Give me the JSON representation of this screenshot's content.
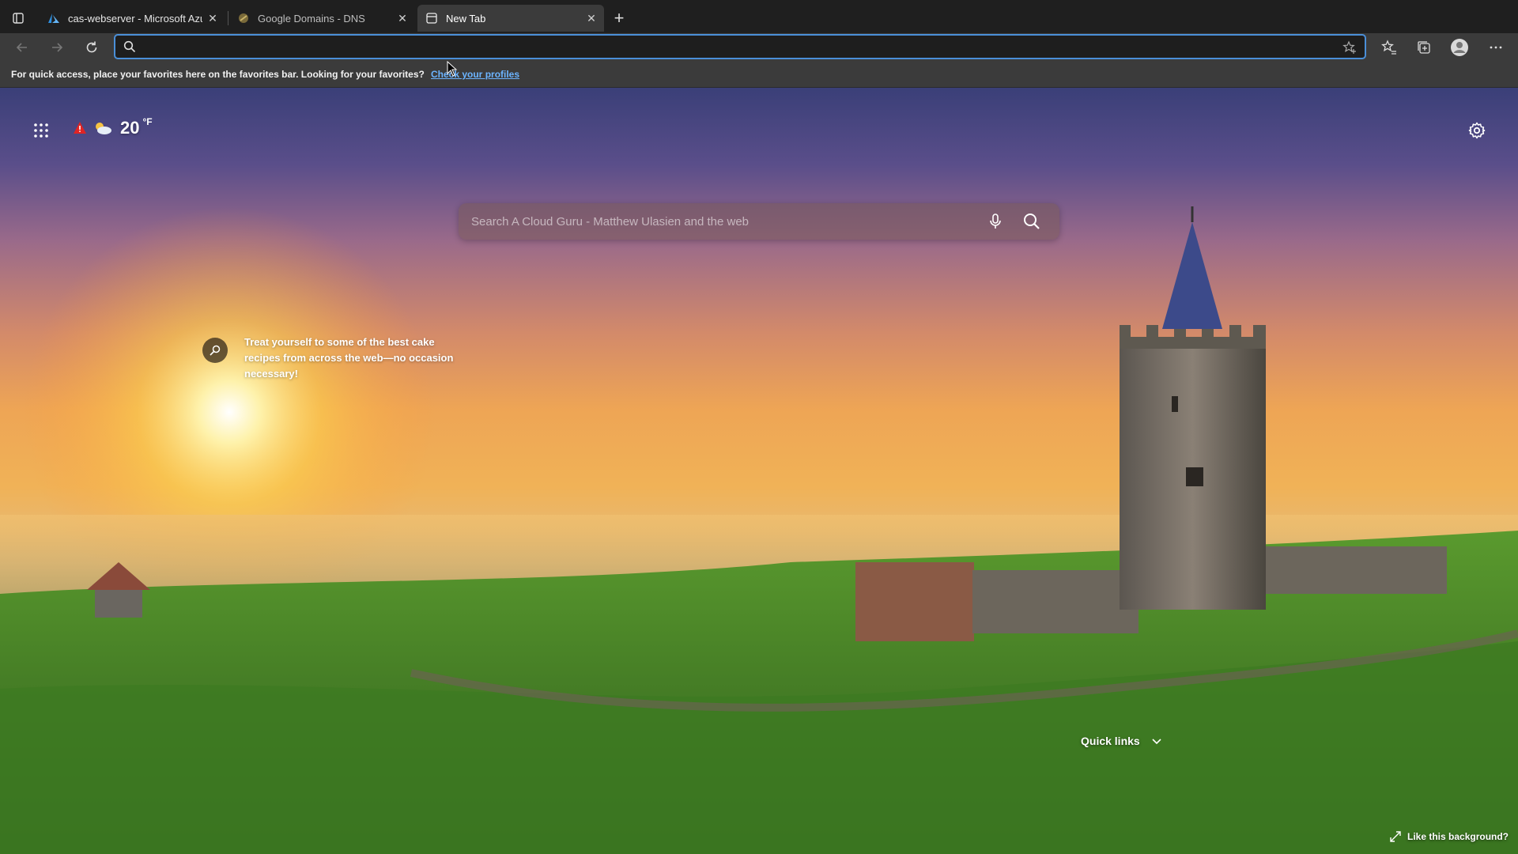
{
  "tabs": [
    {
      "title": "cas-webserver - Microsoft Azure",
      "favicon": "azure-icon",
      "active": false
    },
    {
      "title": "Google Domains - DNS",
      "favicon": "google-domains-icon",
      "active": false
    },
    {
      "title": "New Tab",
      "favicon": "new-tab-page-icon",
      "active": true
    }
  ],
  "toolbar": {
    "address_value": "",
    "address_placeholder": "",
    "accent": "#4a8fd8"
  },
  "favorites_bar": {
    "message": "For quick access, place your favorites here on the favorites bar. Looking for your favorites?",
    "link": "Check your profiles"
  },
  "newtab": {
    "weather": {
      "temp": "20",
      "unit": "°F",
      "alert_icon": "warning-icon",
      "condition_icon": "partly-cloudy-icon"
    },
    "search": {
      "placeholder": "Search A Cloud Guru - Matthew Ulasien and the web"
    },
    "promo": {
      "text": "Treat yourself to some of the best cake recipes from across the web—no occasion necessary!"
    },
    "quick_links": "Quick links",
    "like_background": "Like this background?"
  }
}
